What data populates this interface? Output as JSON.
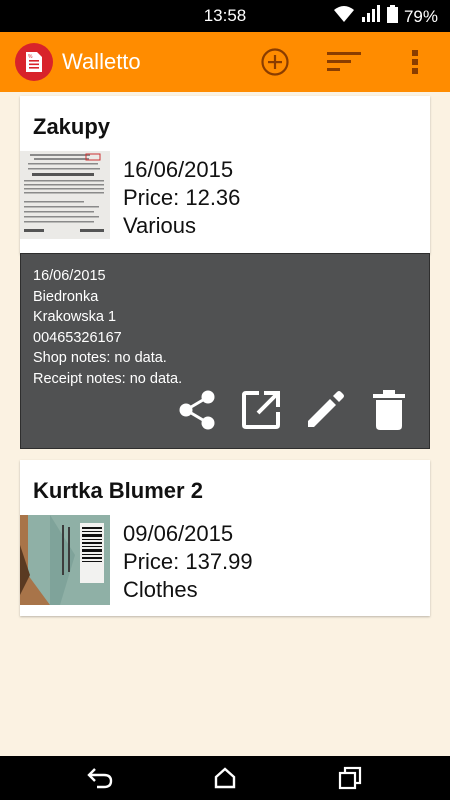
{
  "status_bar": {
    "time": "13:58",
    "battery": "79%",
    "icons": [
      "wifi-icon",
      "signal-icon",
      "battery-icon"
    ]
  },
  "app_bar": {
    "title": "Walletto",
    "logo_icon": "receipt-logo-icon",
    "actions": [
      "add-icon",
      "sort-icon",
      "overflow-menu-icon"
    ]
  },
  "receipts": [
    {
      "title": "Zakupy",
      "date": "16/06/2015",
      "price": "Price: 12.36",
      "category": "Various",
      "thumbnail": "receipt-photo",
      "details": {
        "date": "16/06/2015",
        "shop": "Biedronka",
        "address": "Krakowska 1",
        "number": "00465326167",
        "shop_notes": "Shop notes: no data.",
        "receipt_notes": "Receipt notes: no data."
      },
      "actions": [
        "share-icon",
        "open-external-icon",
        "edit-icon",
        "delete-icon"
      ]
    },
    {
      "title": "Kurtka Blumer 2",
      "date": "09/06/2015",
      "price": "Price: 137.99",
      "category": "Clothes",
      "thumbnail": "tag-photo"
    }
  ],
  "nav_bar": [
    "back-icon",
    "home-icon",
    "recents-icon"
  ],
  "colors": {
    "accent": "#ff8c00",
    "background": "#fbf2e2",
    "details_bg": "#505152"
  }
}
